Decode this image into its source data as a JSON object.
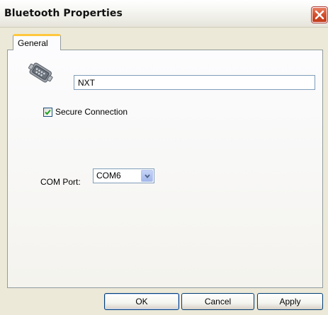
{
  "window": {
    "title": "Bluetooth Properties",
    "close_icon": "close-icon"
  },
  "tabs": [
    {
      "label": "General",
      "selected": true
    }
  ],
  "general": {
    "device_icon": "serial-port-icon",
    "device_name": "NXT",
    "secure_connection": {
      "label": "Secure Connection",
      "checked": true
    },
    "com_port": {
      "label": "COM Port:",
      "selected": "COM6"
    }
  },
  "buttons": {
    "ok": "OK",
    "cancel": "Cancel",
    "apply": "Apply"
  },
  "colors": {
    "tab_accent": "#ffc83c",
    "close_button": "#d4502e",
    "window_bg": "#ECE9D8"
  }
}
